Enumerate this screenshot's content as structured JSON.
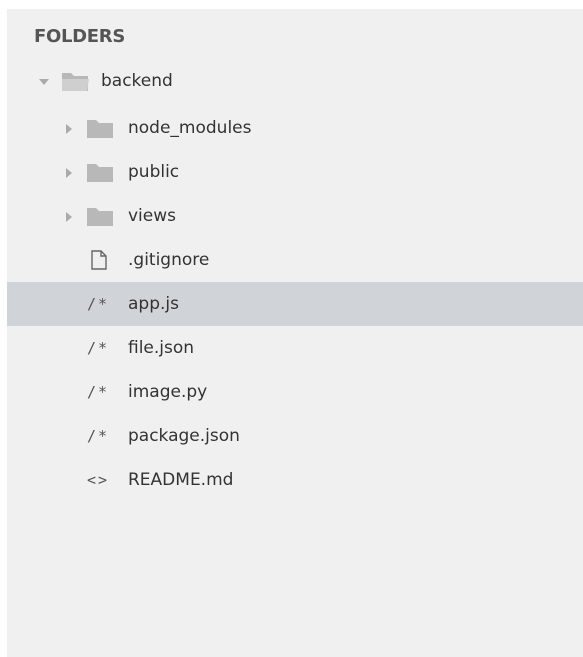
{
  "sidebar": {
    "header": "FOLDERS",
    "root": {
      "label": "backend",
      "icon": "folder-open-icon",
      "expanded": true
    },
    "items": [
      {
        "label": "node_modules",
        "type": "folder",
        "icon": "folder-icon"
      },
      {
        "label": "public",
        "type": "folder",
        "icon": "folder-icon"
      },
      {
        "label": "views",
        "type": "folder",
        "icon": "folder-icon"
      },
      {
        "label": ".gitignore",
        "type": "file",
        "icon": "file-icon"
      },
      {
        "label": "app.js",
        "type": "file",
        "icon": "code-comment-icon",
        "glyph": "/*",
        "selected": true
      },
      {
        "label": "file.json",
        "type": "file",
        "icon": "code-comment-icon",
        "glyph": "/*"
      },
      {
        "label": "image.py",
        "type": "file",
        "icon": "code-comment-icon",
        "glyph": "/*"
      },
      {
        "label": "package.json",
        "type": "file",
        "icon": "code-comment-icon",
        "glyph": "/*"
      },
      {
        "label": "README.md",
        "type": "file",
        "icon": "markup-icon",
        "glyph": "<>"
      }
    ]
  },
  "colors": {
    "background": "#f0f0f0",
    "selected_row": "#d0d3d8",
    "folder_fill": "#b8b8b8",
    "text": "#333333"
  }
}
